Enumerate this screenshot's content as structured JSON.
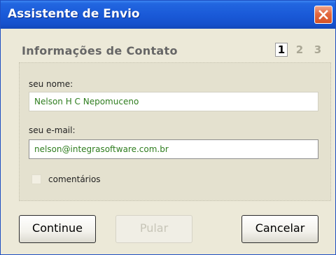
{
  "window": {
    "title": "Assistente de Envio",
    "close_icon": "close-icon"
  },
  "header": {
    "section_title": "Informações de Contato",
    "steps": [
      {
        "label": "1",
        "active": true
      },
      {
        "label": "2",
        "active": false
      },
      {
        "label": "3",
        "active": false
      }
    ]
  },
  "form": {
    "name_label": "seu nome:",
    "name_value": "Nelson H C Nepomuceno",
    "email_label": "seu e-mail:",
    "email_value": "nelson@integrasoftware.com.br",
    "comments_label": "comentários",
    "comments_checked": false
  },
  "buttons": {
    "continue_label": "Continue",
    "skip_label": "Pular",
    "cancel_label": "Cancelar"
  },
  "colors": {
    "titlebar": "#1a5ad8",
    "close_button": "#e2683f",
    "input_text": "#2e7d1e",
    "window_bg": "#ece9d8"
  }
}
